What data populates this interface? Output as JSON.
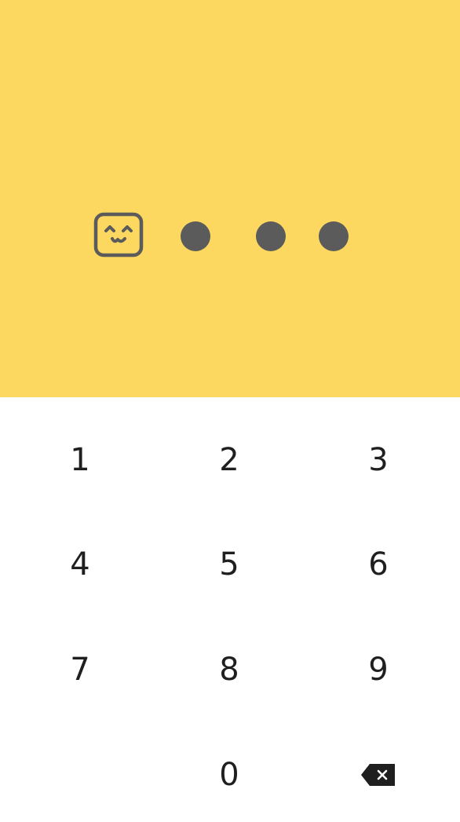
{
  "theme": {
    "accent": "#fcd860",
    "dot_color": "#5b5b5b",
    "key_text": "#1f1f1f"
  },
  "pin": {
    "length": 4,
    "entered": 4,
    "reveal_icon": "smiling-face-icon",
    "masked_icon": "filled-dot"
  },
  "keypad": {
    "keys": [
      "1",
      "2",
      "3",
      "4",
      "5",
      "6",
      "7",
      "8",
      "9",
      "0"
    ],
    "backspace_icon": "backspace-icon"
  }
}
